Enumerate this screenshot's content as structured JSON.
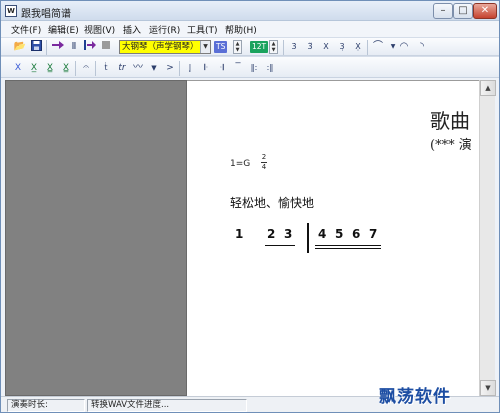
{
  "window": {
    "title": "跟我唱简谱",
    "icon_text": "W"
  },
  "menu": {
    "items": [
      "文件(F)",
      "编辑(E)",
      "视图(V)",
      "插入",
      "运行(R)",
      "工具(T)",
      "帮助(H)"
    ]
  },
  "toolbar": {
    "instrument": "大钢琴（声学钢琴）",
    "ts_badge": "TS",
    "key_badge": "12T",
    "colors": {
      "instrument_bg": "#ffff00",
      "ts_badge": "#5a6fd6",
      "key_badge": "#1aa35d"
    }
  },
  "score": {
    "title": "歌曲",
    "subtitle": "(***  演",
    "key": "1=G",
    "time_top": "2",
    "time_bottom": "4",
    "lyric": "轻松地、愉快地",
    "notes": [
      "1",
      "2",
      "3",
      "4",
      "5",
      "6",
      "7"
    ]
  },
  "status": {
    "duration_label": "演奏时长:",
    "convert_label": "转换WAV文件进度..."
  },
  "watermark": "飘荡软件"
}
